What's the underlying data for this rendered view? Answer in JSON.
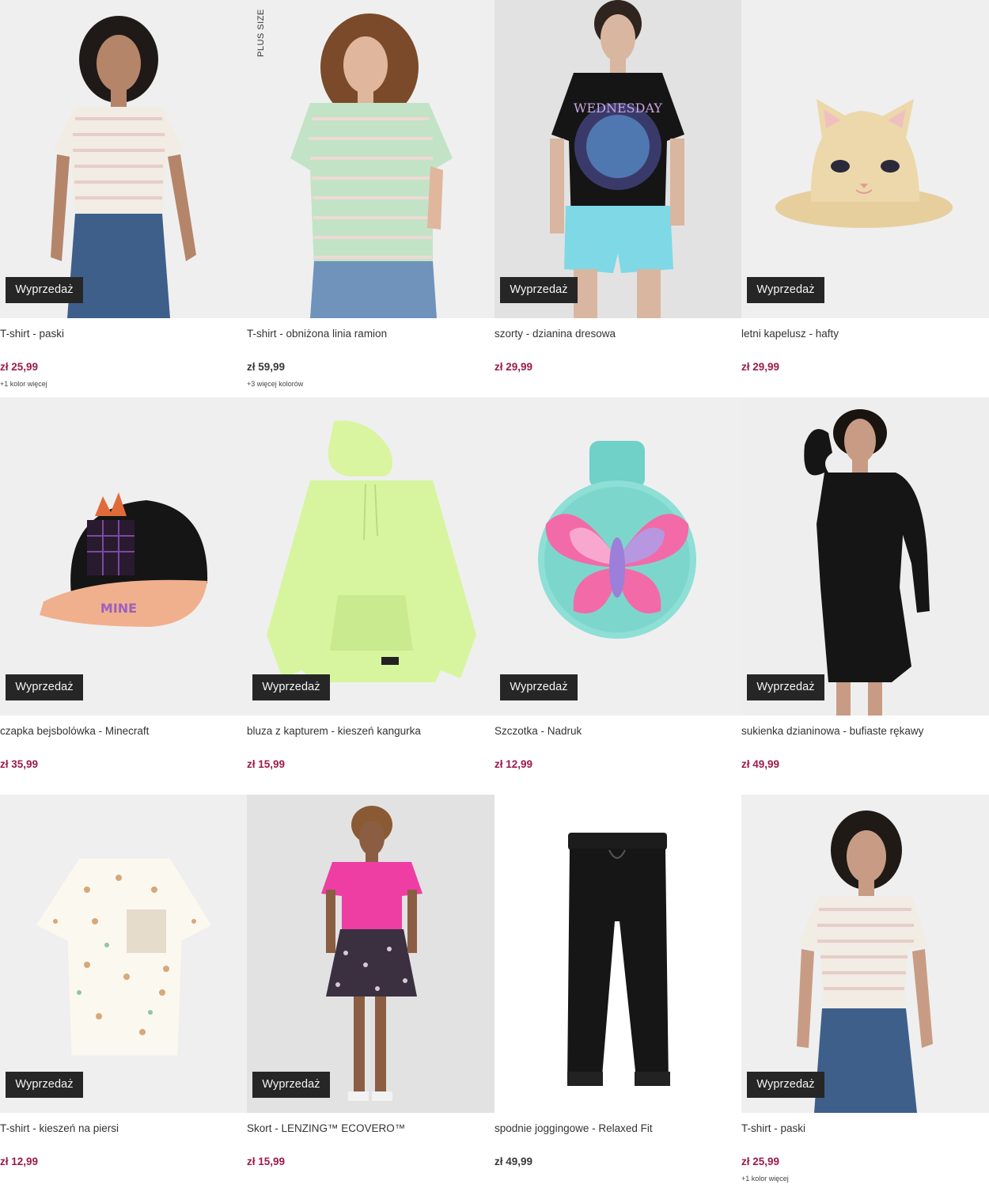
{
  "badge_label": "Wyprzedaż",
  "plus_size_label": "PLUS SIZE",
  "products": [
    {
      "name": "T-shirt - paski",
      "price": "zł 25,99",
      "more_colors": "+1 kolor więcej"
    },
    {
      "name": "T-shirt - obniżona linia ramion",
      "price": "zł 59,99",
      "more_colors": "+3 więcej kolorów"
    },
    {
      "name": "szorty - dzianina dresowa",
      "price": "zł 29,99"
    },
    {
      "name": "letni kapelusz - hafty",
      "price": "zł 29,99"
    },
    {
      "name": "czapka bejsbolówka - Minecraft",
      "price": "zł 35,99"
    },
    {
      "name": "bluza z kapturem - kieszeń kangurka",
      "price": "zł 15,99"
    },
    {
      "name": "Szczotka - Nadruk",
      "price": "zł 12,99"
    },
    {
      "name": "sukienka dzianinowa - bufiaste rękawy",
      "price": "zł 49,99"
    },
    {
      "name": "T-shirt - kieszeń na piersi",
      "price": "zł 12,99"
    },
    {
      "name": "Skort - LENZING™ ECOVERO™",
      "price": "zł 15,99"
    },
    {
      "name": "spodnie joggingowe - Relaxed Fit",
      "price": "zł 49,99"
    },
    {
      "name": "T-shirt - paski",
      "price": "zł 25,99",
      "more_colors": "+1 kolor więcej"
    }
  ],
  "colors": {
    "sale_price": "#9c1b4b",
    "regular_price": "#3a3a3a",
    "badge_bg": "#262626"
  }
}
